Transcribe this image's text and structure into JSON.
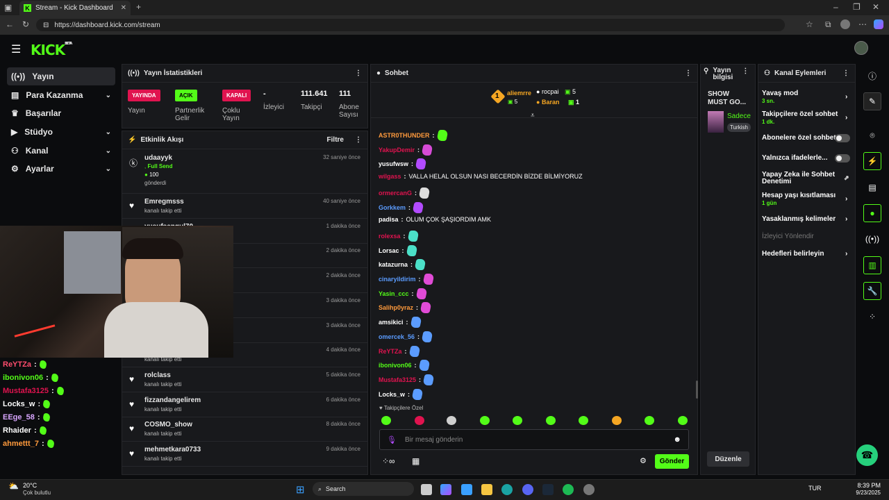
{
  "browser": {
    "tab_title": "Stream - Kick Dashboard",
    "url": "https://dashboard.kick.com/stream"
  },
  "logo": "KICK",
  "logo_badge": "BETA",
  "nav": [
    {
      "label": "Yayın",
      "icon": "broadcast-icon",
      "active": true
    },
    {
      "label": "Para Kazanma",
      "icon": "money-icon",
      "expandable": true
    },
    {
      "label": "Başarılar",
      "icon": "trophy-icon"
    },
    {
      "label": "Stüdyo",
      "icon": "studio-icon",
      "expandable": true
    },
    {
      "label": "Kanal",
      "icon": "channel-icon",
      "expandable": true
    },
    {
      "label": "Ayarlar",
      "icon": "gear-icon",
      "expandable": true
    }
  ],
  "stats": {
    "title": "Yayın İstatistikleri",
    "items": [
      {
        "badge": "YAYINDA",
        "label": "Yayın",
        "color": "#e0134f"
      },
      {
        "badge": "AÇIK",
        "label": "Partnerlik Gelir",
        "color": "#53fc18"
      },
      {
        "badge": "KAPALI",
        "label": "Çoklu Yayın",
        "color": "#e0134f"
      },
      {
        "value": "-",
        "label": "İzleyici"
      },
      {
        "value": "111.641",
        "label": "Takipçi"
      },
      {
        "value": "111",
        "label": "Abone Sayısı"
      }
    ]
  },
  "activity": {
    "title": "Etkinlik Akışı",
    "filter": "Filtre",
    "first": {
      "name": "udaayyk",
      "sub_type": "Full Send",
      "amount": "100",
      "action": "gönderdi",
      "time": "32 saniye önce"
    },
    "items": [
      {
        "name": "Emregmsss",
        "action": "kanalı takip etti",
        "time": "40 saniye önce"
      },
      {
        "name": "yusufsengul70",
        "action": "kanalı takip etti",
        "time": "1 dakika önce"
      },
      {
        "name": "",
        "action": "",
        "time": "2 dakika önce"
      },
      {
        "name": "",
        "action": "",
        "time": "2 dakika önce"
      },
      {
        "name": "",
        "action": "",
        "time": "3 dakika önce"
      },
      {
        "name": "",
        "action": "",
        "time": "3 dakika önce"
      },
      {
        "name": "",
        "action": "kanalı takip etti",
        "time": "4 dakika önce"
      },
      {
        "name": "rolclass",
        "action": "kanalı takip etti",
        "time": "5 dakika önce"
      },
      {
        "name": "fizzandangelirem",
        "action": "kanalı takip etti",
        "time": "6 dakika önce"
      },
      {
        "name": "COSMO_show",
        "action": "kanalı takip etti",
        "time": "8 dakika önce"
      },
      {
        "name": "mehmetkara0733",
        "action": "kanalı takip etti",
        "time": "9 dakika önce"
      }
    ]
  },
  "overlay_chat": [
    {
      "name": "ReYTZa",
      "color": "#ff4d6d"
    },
    {
      "name": "ibonivon06",
      "color": "#53fc18"
    },
    {
      "name": "Mustafa3125",
      "color": "#e0134f"
    },
    {
      "name": "Locks_w",
      "color": "#ffffff"
    },
    {
      "name": "EEge_58",
      "color": "#d8a6ff"
    },
    {
      "name": "Rhaider",
      "color": "#ffffff"
    },
    {
      "name": "ahmettt_7",
      "color": "#ff9a3c"
    }
  ],
  "chat": {
    "title": "Sohbet",
    "top_gifters": [
      {
        "name": "aliemrre",
        "count": "5",
        "rank": "1"
      },
      {
        "name": "rocpai",
        "count": "5"
      },
      {
        "name": "Baran",
        "count": "1"
      }
    ],
    "messages": [
      {
        "name": "ASTR0THUNDER",
        "color": "#ff9a3c",
        "text": ""
      },
      {
        "name": "YakupDemir",
        "color": "#e0134f",
        "text": ""
      },
      {
        "name": "yusufwsw",
        "color": "#ffffff",
        "text": ""
      },
      {
        "name": "wilgass",
        "color": "#e0134f",
        "text": "VALLA HELAL OLSUN NASI BECERDİN BİZDE BİLMİYORUZ"
      },
      {
        "name": "ormercanG",
        "color": "#e0134f",
        "text": ""
      },
      {
        "name": "Gorkkem",
        "color": "#5b9cff",
        "text": ""
      },
      {
        "name": "padisa",
        "color": "#ffffff",
        "text": "OLUM ÇOK ŞAŞIORDIM AMK"
      },
      {
        "name": "rolexsa",
        "color": "#e0134f",
        "text": ""
      },
      {
        "name": "Lorsac",
        "color": "#ffffff",
        "text": ""
      },
      {
        "name": "katazurna",
        "color": "#ffffff",
        "text": ""
      },
      {
        "name": "cinaryildirim",
        "color": "#5b9cff",
        "text": ""
      },
      {
        "name": "Yasin_ccc",
        "color": "#53fc18",
        "text": ""
      },
      {
        "name": "Salihp0yraz",
        "color": "#ff9a3c",
        "text": ""
      },
      {
        "name": "amsikici",
        "color": "#ffffff",
        "text": ""
      },
      {
        "name": "omercek_56",
        "color": "#5b9cff",
        "text": ""
      },
      {
        "name": "ReYTZa",
        "color": "#e0134f",
        "text": ""
      },
      {
        "name": "ibonivon06",
        "color": "#53fc18",
        "text": ""
      },
      {
        "name": "Mustafa3125",
        "color": "#e0134f",
        "text": ""
      },
      {
        "name": "Locks_w",
        "color": "#ffffff",
        "text": ""
      }
    ],
    "follower_mode": "Takipçilere Özel",
    "input_placeholder": "Bir mesaj gönderin",
    "send": "Gönder"
  },
  "stream_info": {
    "title": "Yayın bilgisi",
    "stream_title": "SHOW MUST GO...",
    "category": "Sadece",
    "tag": "Turkish",
    "edit": "Düzenle"
  },
  "channel_actions": {
    "title": "Kanal Eylemleri",
    "items": [
      {
        "label": "Yavaş mod",
        "sub": "3 sn."
      },
      {
        "label": "Takipçilere özel sohbet",
        "sub": "1 dk."
      },
      {
        "label": "Abonelere özel sohbet",
        "sub": ""
      },
      {
        "label": "Yalnızca ifadelerle...",
        "sub": ""
      },
      {
        "label": "Yapay Zeka ile Sohbet Denetimi",
        "sub": ""
      },
      {
        "label": "Hesap yaşı kısıtlaması",
        "sub": "1 gün"
      },
      {
        "label": "Yasaklanmış kelimeler",
        "sub": ""
      },
      {
        "label": "İzleyici Yönlendir",
        "sub": ""
      },
      {
        "label": "Hedefleri belirleyin",
        "sub": ""
      }
    ]
  },
  "taskbar": {
    "weather_temp": "20°C",
    "weather_desc": "Çok bulutlu",
    "search": "Search",
    "lang": "TUR",
    "time": "8:39 PM",
    "date": "9/23/2025"
  }
}
